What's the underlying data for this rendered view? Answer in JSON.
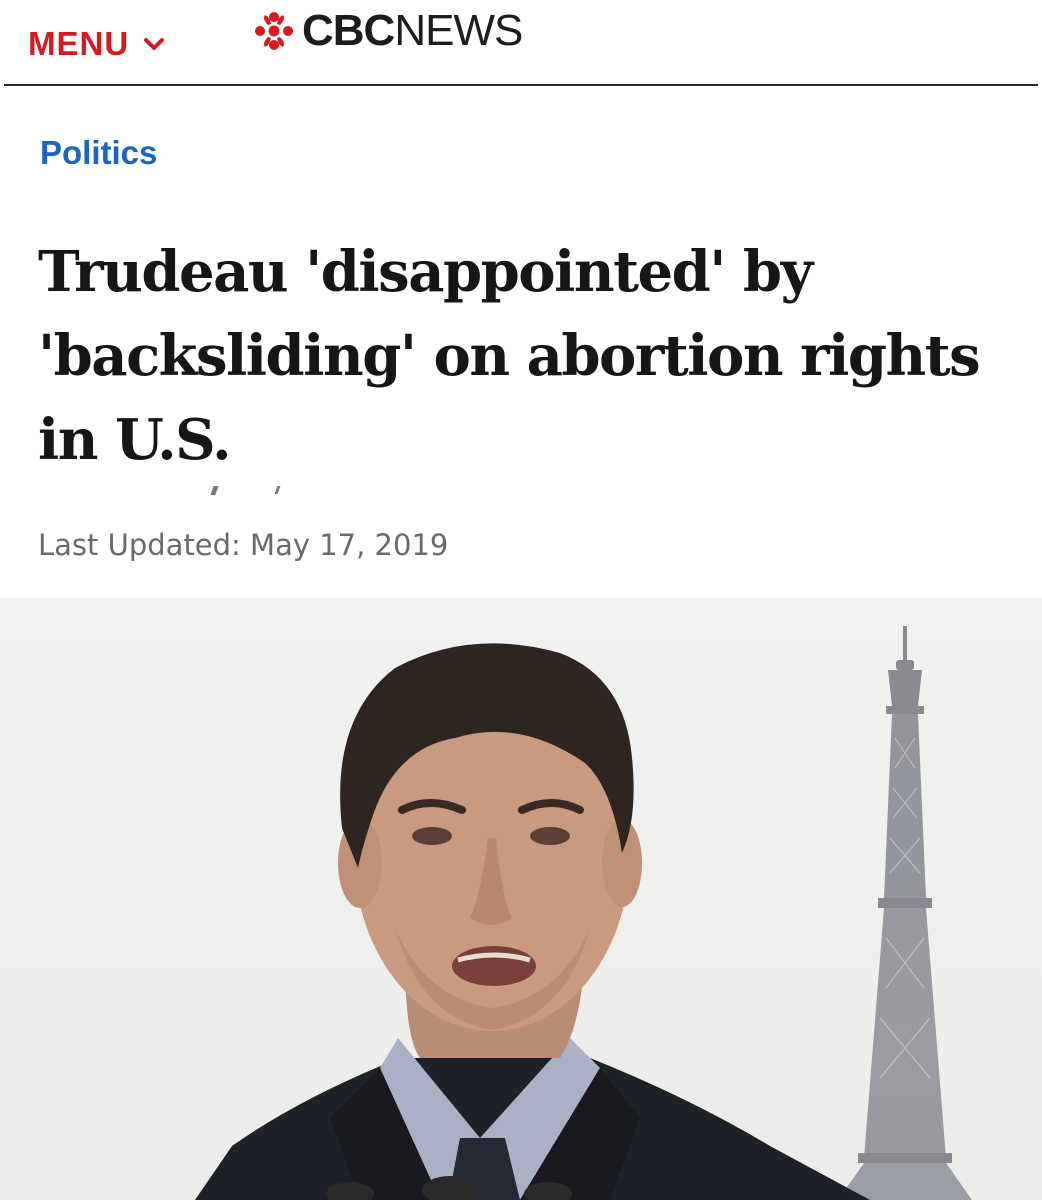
{
  "header": {
    "menu_label": "MENU",
    "brand_bold": "CBC",
    "brand_light": "NEWS",
    "accent_color": "#d71920"
  },
  "article": {
    "section": "Politics",
    "section_color": "#1b63c4",
    "headline": "Trudeau 'disappointed' by 'backsliding' on abortion rights in U.S.",
    "updated": "Last Updated: May 17, 2019"
  },
  "photo": {
    "icon": "lead-photo"
  }
}
